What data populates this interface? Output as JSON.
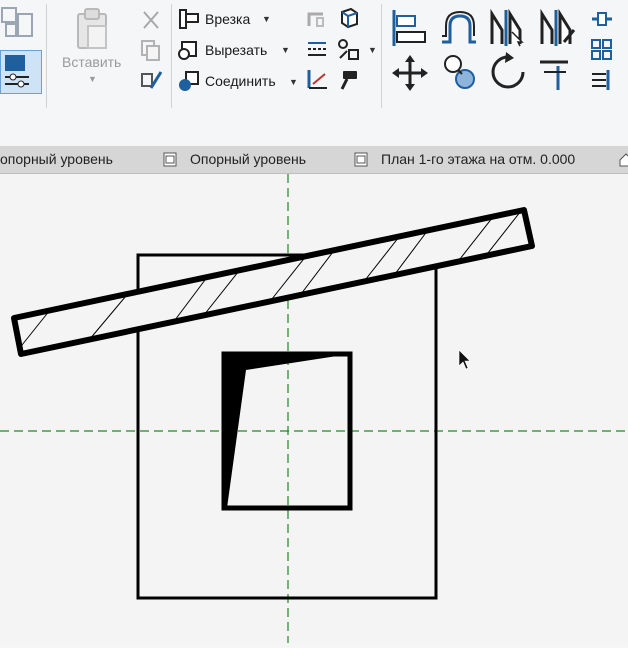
{
  "ribbon": {
    "paste_label": "Вставить",
    "cope_label": "Врезка",
    "cut_label": "Вырезать",
    "join_label": "Соединить"
  },
  "view_bar": {
    "level_left": "опорный уровень",
    "level_right": "Опорный уровень",
    "plan": "План 1-го этажа на отм. 0.000"
  },
  "colors": {
    "gridline": "#1e8a1e",
    "ribbon_bg": "#f5f6f7",
    "accent": "#1f5f9e"
  }
}
